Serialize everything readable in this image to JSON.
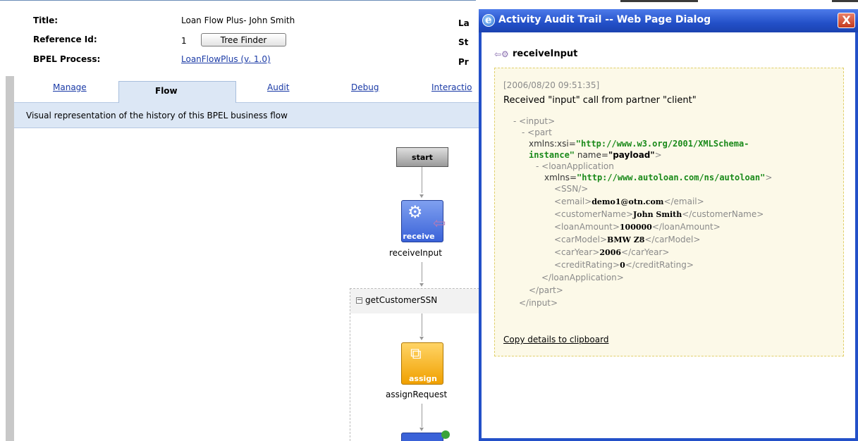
{
  "header": {
    "title_label": "Title:",
    "title_value": "Loan Flow Plus- John Smith",
    "ref_label": "Reference Id:",
    "ref_value": "1",
    "tree_finder_button": "Tree Finder",
    "bpel_label": "BPEL Process:",
    "bpel_value": "LoanFlowPlus (v. 1.0)",
    "side_labels": [
      "La",
      "St",
      "Pr"
    ]
  },
  "tabs": {
    "manage": "Manage",
    "flow": "Flow",
    "audit": "Audit",
    "debug": "Debug",
    "interaction": "Interactio"
  },
  "description": "Visual representation of the history of this BPEL business flow",
  "flow": {
    "start": "start",
    "receive_badge": "receive",
    "receive_name": "receiveInput",
    "scope_toggle": "−",
    "scope_name": "getCustomerSSN",
    "assign_badge": "assign",
    "assign_name": "assignRequest"
  },
  "dialog": {
    "title": "Activity Audit Trail -- Web Page Dialog",
    "close": "X",
    "activity_name": "receiveInput",
    "timestamp": "[2006/08/20 09:51:35]",
    "message": "Received \"input\" call from partner \"client\"",
    "xml": {
      "input_open": "- <input>",
      "part_open": "- <part",
      "xsi_attr": "xmlns:xsi=",
      "xsi_value_1": "\"http://www.w3.org/2001/XMLSchema-",
      "xsi_value_2": "instance\"",
      "name_attr": " name=",
      "name_value": "\"payload\"",
      "part_close_bracket": ">",
      "loan_open": "- <loanApplication",
      "xmlns_attr": "xmlns=",
      "xmlns_value": "\"http://www.autoloan.com/ns/autoloan\"",
      "loan_close_bracket": ">",
      "ssn": "<SSN/>",
      "email_open": "<email>",
      "email_value": "demo1@otn.com",
      "email_close": "</email>",
      "customer_open": "<customerName>",
      "customer_value": "John Smith",
      "customer_close": "</customerName>",
      "amount_open": "<loanAmount>",
      "amount_value": "100000",
      "amount_close": "</loanAmount>",
      "model_open": "<carModel>",
      "model_value": "BMW Z8",
      "model_close": "</carModel>",
      "year_open": "<carYear>",
      "year_value": "2006",
      "year_close": "</carYear>",
      "rating_open": "<creditRating>",
      "rating_value": "0",
      "rating_close": "</creditRating>",
      "loan_close": "</loanApplication>",
      "part_close": "</part>",
      "input_close": "</input>"
    },
    "copy_link": "Copy details to clipboard"
  },
  "colors": {
    "link": "#1a3aa6",
    "tab_active_bg": "#dce7f5",
    "dialog_blue": "#2350c8",
    "xml_namespace": "#1a8a1a",
    "detail_bg": "#fcf9e8"
  },
  "icons": {
    "receive": "gear-icon",
    "assign": "assign-icon",
    "dialog": "ie-icon",
    "close": "close-icon"
  }
}
